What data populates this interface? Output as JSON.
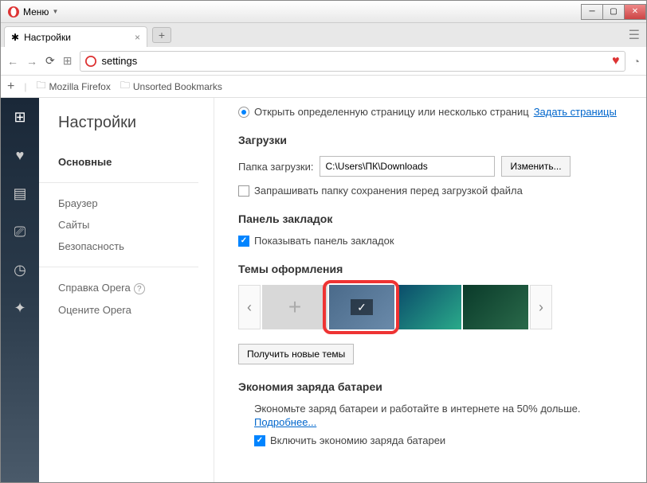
{
  "titlebar": {
    "menu": "Меню"
  },
  "tab": {
    "title": "Настройки"
  },
  "address": {
    "value": "settings"
  },
  "bookmarks_bar": {
    "items": [
      "Mozilla Firefox",
      "Unsorted Bookmarks"
    ]
  },
  "settings_nav": {
    "title": "Настройки",
    "active": "Основные",
    "items": [
      "Браузер",
      "Сайты",
      "Безопасность"
    ],
    "help_items": [
      "Справка Opera",
      "Оцените Opera"
    ]
  },
  "startup": {
    "radio_label": "Открыть определенную страницу или несколько страниц",
    "set_pages": "Задать страницы"
  },
  "downloads": {
    "heading": "Загрузки",
    "folder_label": "Папка загрузки:",
    "folder_value": "C:\\Users\\ПК\\Downloads",
    "change_btn": "Изменить...",
    "ask_checkbox": "Запрашивать папку сохранения перед загрузкой файла"
  },
  "bookmarks": {
    "heading": "Панель закладок",
    "show_checkbox": "Показывать панель закладок"
  },
  "themes": {
    "heading": "Темы оформления",
    "get_btn": "Получить новые темы"
  },
  "battery": {
    "heading": "Экономия заряда батареи",
    "desc": "Экономьте заряд батареи и работайте в интернете на 50% дольше.",
    "more": "Подробнее...",
    "enable": "Включить экономию заряда батареи"
  }
}
